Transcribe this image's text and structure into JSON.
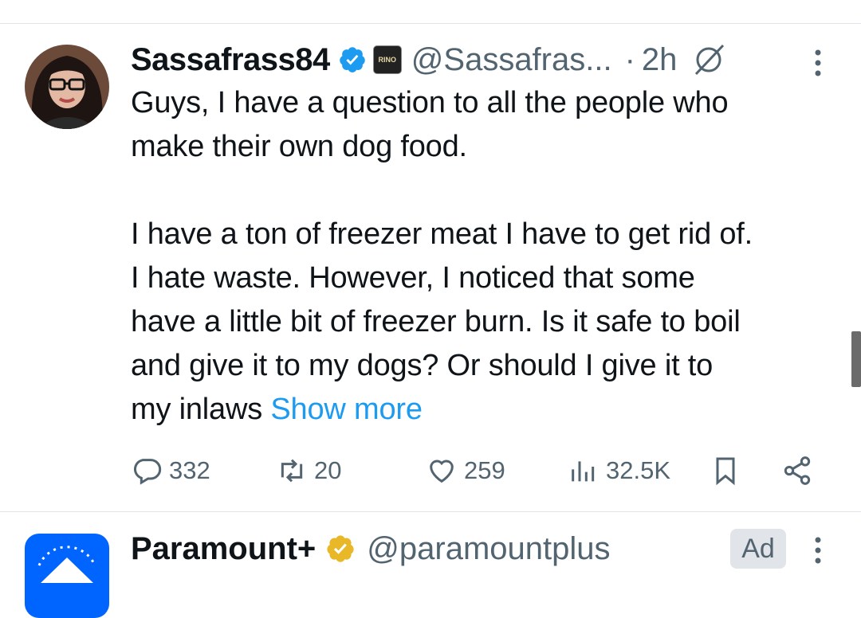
{
  "tweet": {
    "display_name": "Sassafrass84",
    "handle": "@Sassafras...",
    "separator": "·",
    "time": "2h",
    "affiliation_badge_text": "RINO",
    "text_main": "Guys, I have a question to all the people who\nmake their own dog food.\n\nI have a ton of freezer meat I have to get rid of.\nI hate waste. However, I noticed that some\nhave a little bit of freezer burn. Is it safe to boil\nand give it to my dogs? Or should I give it to\nmy inlaws ",
    "show_more": "Show more",
    "actions": {
      "replies": "332",
      "reposts": "20",
      "likes": "259",
      "views": "32.5K"
    }
  },
  "ad_tweet": {
    "display_name": "Paramount+",
    "handle": "@paramountplus",
    "ad_label": "Ad"
  },
  "colors": {
    "accent": "#1d9bf0",
    "secondary_text": "#536471",
    "divider": "#e1e4e8",
    "gold_badge": "#e8b829"
  },
  "icons": [
    "verified-badge-icon",
    "affiliation-badge-icon",
    "grok-icon",
    "more-icon",
    "reply-icon",
    "repost-icon",
    "like-icon",
    "views-icon",
    "bookmark-icon",
    "share-icon",
    "gold-verified-badge-icon"
  ]
}
